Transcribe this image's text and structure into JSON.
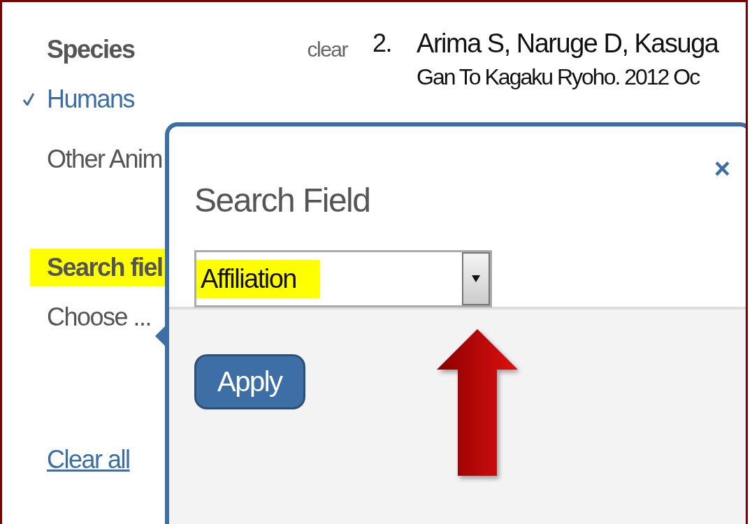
{
  "sidebar": {
    "filter_groups": [
      {
        "title": "Species",
        "highlighted": false,
        "clear_link": "clear",
        "options": [
          {
            "label": "Humans",
            "checked": true
          },
          {
            "label": "Other Anim",
            "checked": false
          }
        ]
      },
      {
        "title": "Search fiel",
        "highlighted": true,
        "options": [
          {
            "label": "Choose ...",
            "checked": false
          }
        ]
      }
    ],
    "clear_all": "Clear all"
  },
  "results": [
    {
      "number": "2.",
      "authors": "Arima S, Naruge D, Kasuga",
      "journal": "Gan To Kagaku Ryoho. 2012 Oc"
    }
  ],
  "dialog": {
    "title": "Search Field",
    "close": "×",
    "select": {
      "value": "Affiliation",
      "highlighted": true
    },
    "buttons": [
      "Apply"
    ]
  }
}
